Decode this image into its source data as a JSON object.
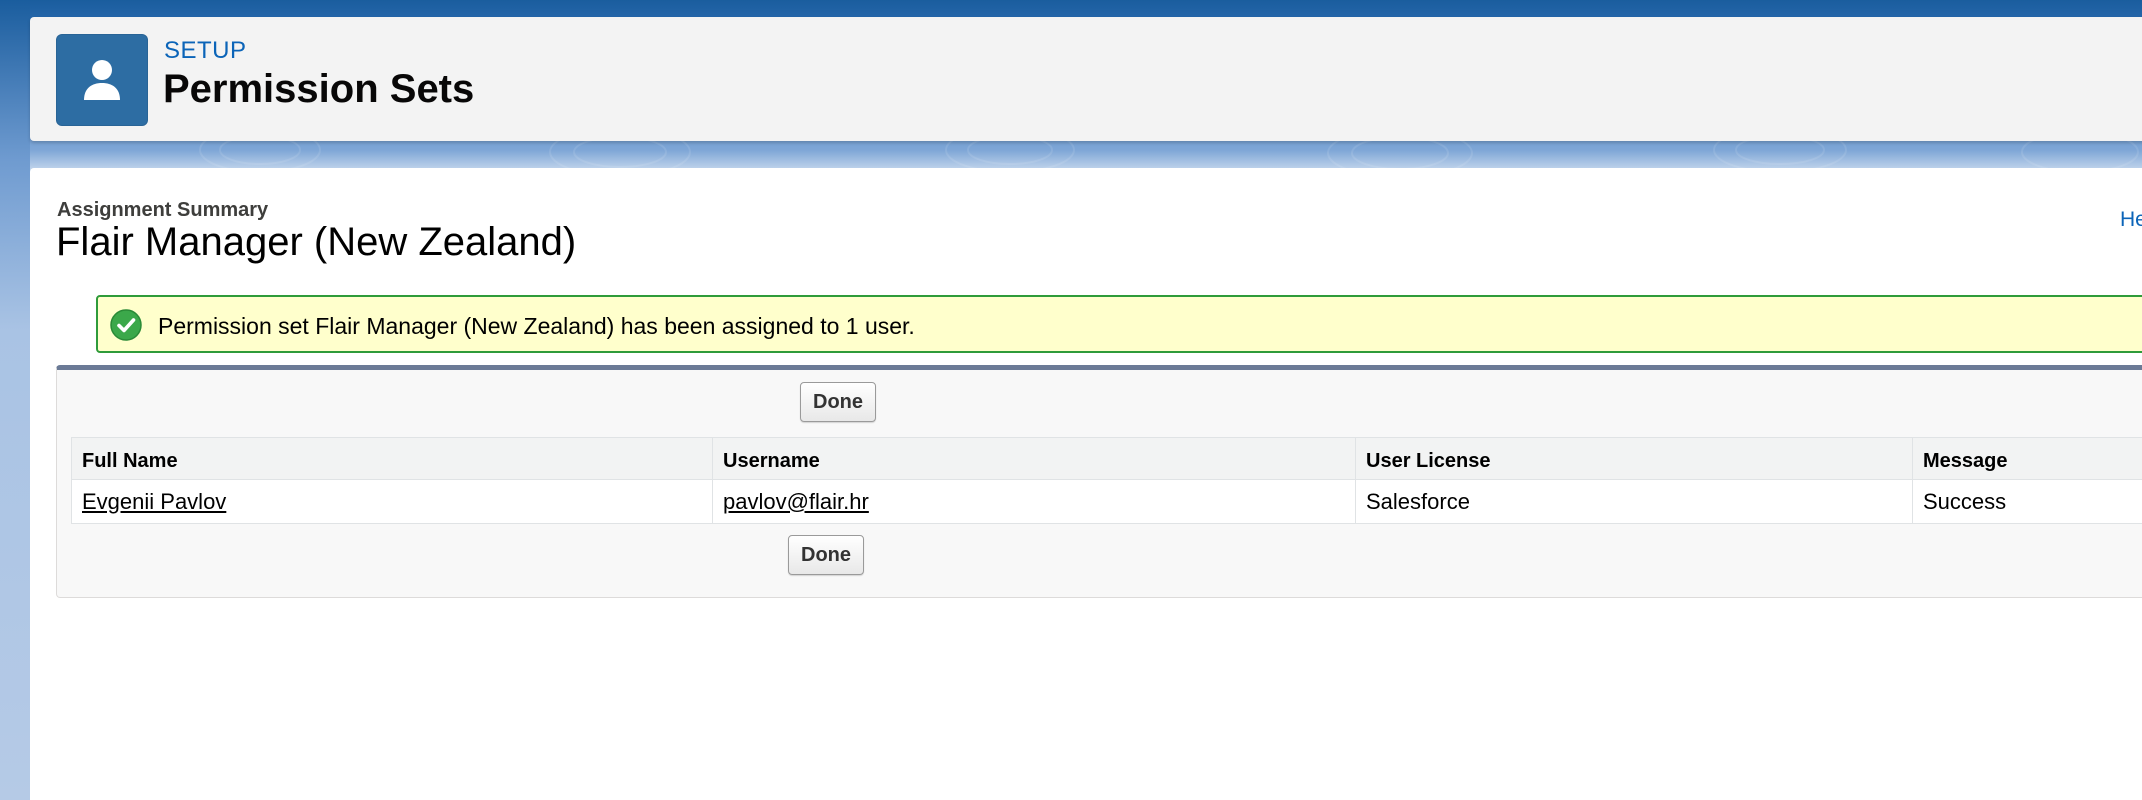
{
  "header": {
    "eyebrow": "SETUP",
    "title": "Permission Sets",
    "icon": "user-icon"
  },
  "summary": {
    "label": "Assignment Summary",
    "title": "Flair Manager (New Zealand)",
    "help_link": "He"
  },
  "banner": {
    "icon": "checkmark-circle-icon",
    "message": "Permission set Flair Manager (New Zealand) has been assigned to 1 user."
  },
  "buttons": {
    "done_top": "Done",
    "done_bottom": "Done"
  },
  "table": {
    "columns": [
      "Full Name",
      "Username",
      "User License",
      "Message"
    ],
    "rows": [
      {
        "full_name": "Evgenii Pavlov",
        "username": "pavlov@flair.hr",
        "user_license": "Salesforce",
        "message": "Success"
      }
    ]
  },
  "colors": {
    "brand_blue": "#2d6da3",
    "link_blue": "#0b64b8",
    "success_green": "#2f9b3a",
    "banner_yellow": "#ffffcc"
  }
}
